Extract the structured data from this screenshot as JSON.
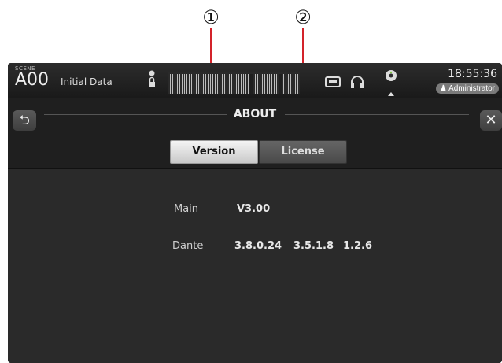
{
  "callouts": {
    "one": "①",
    "two": "②"
  },
  "header": {
    "scene_tag": "SCENE",
    "scene_number": "A00",
    "scene_title": "Initial Data",
    "clock": "18:55:36",
    "user": "Administrator"
  },
  "screen": {
    "title": "ABOUT",
    "back_icon": "⮌",
    "close_icon": "✕"
  },
  "tabs": {
    "version": "Version",
    "license": "License"
  },
  "info": {
    "main_label": "Main",
    "main_value": "V3.00",
    "dante_label": "Dante",
    "dante_values": [
      "3.8.0.24",
      "3.5.1.8",
      "1.2.6"
    ]
  },
  "colors": {
    "callout_line": "#d3232a",
    "background": "#1f1f1f",
    "panel": "#2a2a2a"
  }
}
